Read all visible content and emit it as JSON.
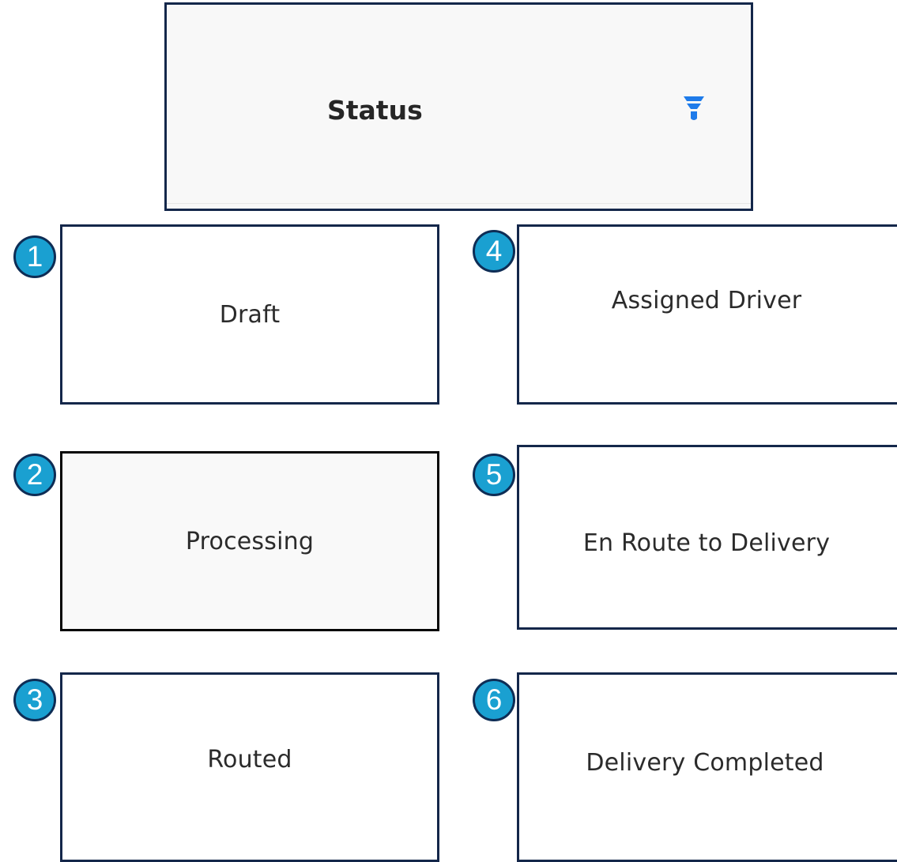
{
  "header": {
    "title": "Status",
    "filter_icon": "filter-funnel-icon",
    "filter_color": "#1e7bea"
  },
  "cards": [
    {
      "number": "1",
      "label": "Draft"
    },
    {
      "number": "2",
      "label": "Processing",
      "selected": true
    },
    {
      "number": "3",
      "label": "Routed"
    },
    {
      "number": "4",
      "label": "Assigned Driver"
    },
    {
      "number": "5",
      "label": "En Route to Delivery"
    },
    {
      "number": "6",
      "label": "Delivery Completed"
    }
  ],
  "colors": {
    "border": "#14274a",
    "badge_fill": "#1aa0d1",
    "badge_border": "#0e2d55",
    "selected_border": "#050505"
  }
}
